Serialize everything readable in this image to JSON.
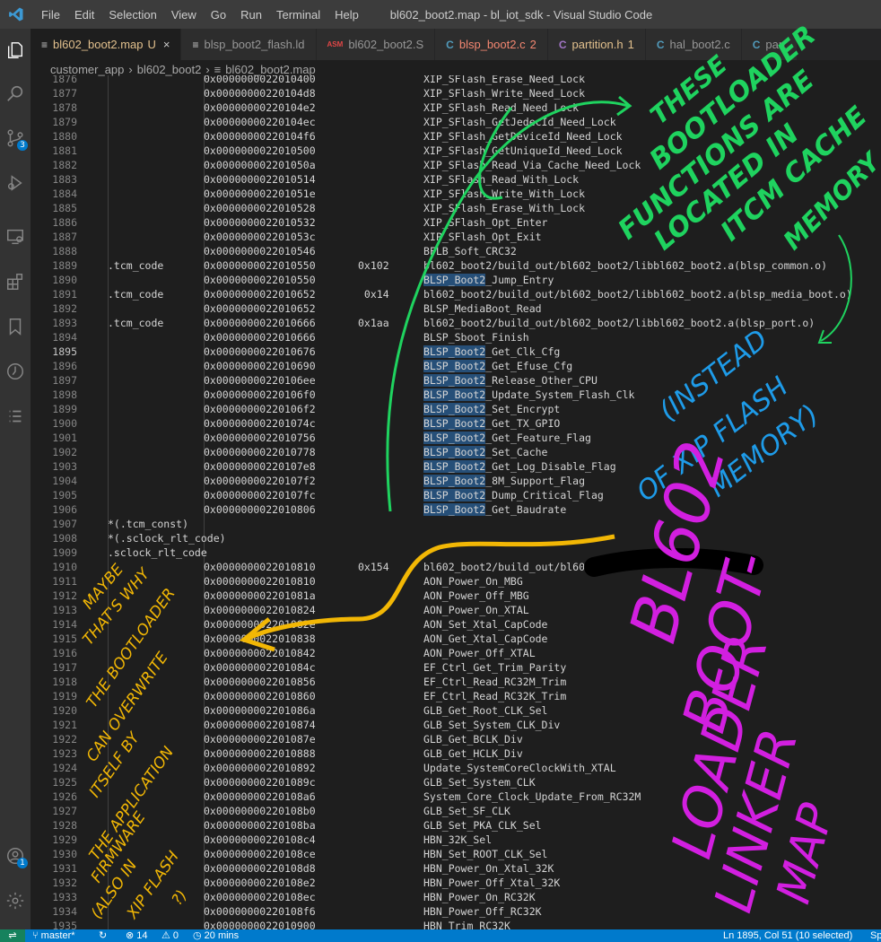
{
  "titlebar": {
    "menu": [
      "File",
      "Edit",
      "Selection",
      "View",
      "Go",
      "Run",
      "Terminal",
      "Help"
    ],
    "title": "bl602_boot2.map - bl_iot_sdk - Visual Studio Code"
  },
  "activity": {
    "icons": [
      "explorer-icon",
      "search-icon",
      "source-control-icon",
      "run-debug-icon",
      "remote-explorer-icon",
      "extensions-icon",
      "bookmarks-icon",
      "timeline-icon",
      "outline-icon",
      "account-icon",
      "settings-gear-icon"
    ],
    "scm_badge": "3",
    "account_badge": "1"
  },
  "tabs": [
    {
      "icon": "≡",
      "icon_color": "#cccccc",
      "label": "bl602_boot2.map",
      "suffix": "U",
      "active": true
    },
    {
      "icon": "≡",
      "icon_color": "#cccccc",
      "label": "blsp_boot2_flash.ld",
      "suffix": "",
      "active": false
    },
    {
      "icon": "ASM",
      "icon_color": "#e04646",
      "label": "bl602_boot2.S",
      "suffix": "",
      "active": false
    },
    {
      "icon": "C",
      "icon_color": "#519aba",
      "label": "blsp_boot2.c",
      "suffix": "2",
      "active": false,
      "color": "#f48771"
    },
    {
      "icon": "C",
      "icon_color": "#a074c4",
      "label": "partition.h",
      "suffix": "1",
      "active": false,
      "color": "#e2c08d"
    },
    {
      "icon": "C",
      "icon_color": "#519aba",
      "label": "hal_boot2.c",
      "suffix": "",
      "active": false
    },
    {
      "icon": "C",
      "icon_color": "#519aba",
      "label": "part",
      "suffix": "",
      "active": false
    }
  ],
  "breadcrumb": [
    "customer_app",
    "bl602_boot2",
    "bl602_boot2.map"
  ],
  "code": {
    "selection": "BLSP_Boot2",
    "current_line": "1895",
    "lines": [
      {
        "n": "1876",
        "a": "",
        "b": "0x0000000022010400",
        "c": "",
        "d": "XIP_SFlash_Erase_Need_Lock"
      },
      {
        "n": "1877",
        "a": "",
        "b": "0x00000000220104d8",
        "c": "",
        "d": "XIP_SFlash_Write_Need_Lock"
      },
      {
        "n": "1878",
        "a": "",
        "b": "0x00000000220104e2",
        "c": "",
        "d": "XIP_SFlash_Read_Need_Lock"
      },
      {
        "n": "1879",
        "a": "",
        "b": "0x00000000220104ec",
        "c": "",
        "d": "XIP_SFlash_GetJedecId_Need_Lock"
      },
      {
        "n": "1880",
        "a": "",
        "b": "0x00000000220104f6",
        "c": "",
        "d": "XIP_SFlash_GetDeviceId_Need_Lock"
      },
      {
        "n": "1881",
        "a": "",
        "b": "0x0000000022010500",
        "c": "",
        "d": "XIP_SFlash_GetUniqueId_Need_Lock"
      },
      {
        "n": "1882",
        "a": "",
        "b": "0x000000002201050a",
        "c": "",
        "d": "XIP_SFlash_Read_Via_Cache_Need_Lock"
      },
      {
        "n": "1883",
        "a": "",
        "b": "0x0000000022010514",
        "c": "",
        "d": "XIP_SFlash_Read_With_Lock"
      },
      {
        "n": "1884",
        "a": "",
        "b": "0x000000002201051e",
        "c": "",
        "d": "XIP_SFlash_Write_With_Lock"
      },
      {
        "n": "1885",
        "a": "",
        "b": "0x0000000022010528",
        "c": "",
        "d": "XIP_SFlash_Erase_With_Lock"
      },
      {
        "n": "1886",
        "a": "",
        "b": "0x0000000022010532",
        "c": "",
        "d": "XIP_SFlash_Opt_Enter"
      },
      {
        "n": "1887",
        "a": "",
        "b": "0x000000002201053c",
        "c": "",
        "d": "XIP_SFlash_Opt_Exit"
      },
      {
        "n": "1888",
        "a": "",
        "b": "0x0000000022010546",
        "c": "",
        "d": "BFLB_Soft_CRC32"
      },
      {
        "n": "1889",
        "a": ".tcm_code",
        "b": "0x0000000022010550",
        "c": "0x102",
        "d": "bl602_boot2/build_out/bl602_boot2/libbl602_boot2.a(blsp_common.o)"
      },
      {
        "n": "1890",
        "a": "",
        "b": "0x0000000022010550",
        "c": "",
        "d": "BLSP_Boot2_Jump_Entry"
      },
      {
        "n": "1891",
        "a": ".tcm_code",
        "b": "0x0000000022010652",
        "c": " 0x14",
        "d": "bl602_boot2/build_out/bl602_boot2/libbl602_boot2.a(blsp_media_boot.o)"
      },
      {
        "n": "1892",
        "a": "",
        "b": "0x0000000022010652",
        "c": "",
        "d": "BLSP_MediaBoot_Read"
      },
      {
        "n": "1893",
        "a": ".tcm_code",
        "b": "0x0000000022010666",
        "c": "0x1aa",
        "d": "bl602_boot2/build_out/bl602_boot2/libbl602_boot2.a(blsp_port.o)"
      },
      {
        "n": "1894",
        "a": "",
        "b": "0x0000000022010666",
        "c": "",
        "d": "BLSP_Sboot_Finish"
      },
      {
        "n": "1895",
        "a": "",
        "b": "0x0000000022010676",
        "c": "",
        "d": "BLSP_Boot2_Get_Clk_Cfg"
      },
      {
        "n": "1896",
        "a": "",
        "b": "0x0000000022010690",
        "c": "",
        "d": "BLSP_Boot2_Get_Efuse_Cfg"
      },
      {
        "n": "1897",
        "a": "",
        "b": "0x00000000220106ee",
        "c": "",
        "d": "BLSP_Boot2_Release_Other_CPU"
      },
      {
        "n": "1898",
        "a": "",
        "b": "0x00000000220106f0",
        "c": "",
        "d": "BLSP_Boot2_Update_System_Flash_Clk"
      },
      {
        "n": "1899",
        "a": "",
        "b": "0x00000000220106f2",
        "c": "",
        "d": "BLSP_Boot2_Set_Encrypt"
      },
      {
        "n": "1900",
        "a": "",
        "b": "0x000000002201074c",
        "c": "",
        "d": "BLSP_Boot2_Get_TX_GPIO"
      },
      {
        "n": "1901",
        "a": "",
        "b": "0x0000000022010756",
        "c": "",
        "d": "BLSP_Boot2_Get_Feature_Flag"
      },
      {
        "n": "1902",
        "a": "",
        "b": "0x0000000022010778",
        "c": "",
        "d": "BLSP_Boot2_Set_Cache"
      },
      {
        "n": "1903",
        "a": "",
        "b": "0x00000000220107e8",
        "c": "",
        "d": "BLSP_Boot2_Get_Log_Disable_Flag"
      },
      {
        "n": "1904",
        "a": "",
        "b": "0x00000000220107f2",
        "c": "",
        "d": "BLSP_Boot2_8M_Support_Flag"
      },
      {
        "n": "1905",
        "a": "",
        "b": "0x00000000220107fc",
        "c": "",
        "d": "BLSP_Boot2_Dump_Critical_Flag"
      },
      {
        "n": "1906",
        "a": "",
        "b": "0x0000000022010806",
        "c": "",
        "d": "BLSP_Boot2_Get_Baudrate"
      },
      {
        "n": "1907",
        "a": "*(.tcm_const)",
        "b": "",
        "c": "",
        "d": ""
      },
      {
        "n": "1908",
        "a": "*(.sclock_rlt_code)",
        "b": "",
        "c": "",
        "d": ""
      },
      {
        "n": "1909",
        "a": ".sclock_rlt_code",
        "b": "",
        "c": "",
        "d": ""
      },
      {
        "n": "1910",
        "a": "",
        "b": "0x0000000022010810",
        "c": "0x154",
        "d": "bl602_boot2/build_out/bl602_st"
      },
      {
        "n": "1911",
        "a": "",
        "b": "0x0000000022010810",
        "c": "",
        "d": "AON_Power_On_MBG"
      },
      {
        "n": "1912",
        "a": "",
        "b": "0x000000002201081a",
        "c": "",
        "d": "AON_Power_Off_MBG"
      },
      {
        "n": "1913",
        "a": "",
        "b": "0x0000000022010824",
        "c": "",
        "d": "AON_Power_On_XTAL"
      },
      {
        "n": "1914",
        "a": "",
        "b": "0x000000002201082e",
        "c": "",
        "d": "AON_Set_Xtal_CapCode"
      },
      {
        "n": "1915",
        "a": "",
        "b": "0x0000000022010838",
        "c": "",
        "d": "AON_Get_Xtal_CapCode"
      },
      {
        "n": "1916",
        "a": "",
        "b": "0x0000000022010842",
        "c": "",
        "d": "AON_Power_Off_XTAL"
      },
      {
        "n": "1917",
        "a": "",
        "b": "0x000000002201084c",
        "c": "",
        "d": "EF_Ctrl_Get_Trim_Parity"
      },
      {
        "n": "1918",
        "a": "",
        "b": "0x0000000022010856",
        "c": "",
        "d": "EF_Ctrl_Read_RC32M_Trim"
      },
      {
        "n": "1919",
        "a": "",
        "b": "0x0000000022010860",
        "c": "",
        "d": "EF_Ctrl_Read_RC32K_Trim"
      },
      {
        "n": "1920",
        "a": "",
        "b": "0x000000002201086a",
        "c": "",
        "d": "GLB_Get_Root_CLK_Sel"
      },
      {
        "n": "1921",
        "a": "",
        "b": "0x0000000022010874",
        "c": "",
        "d": "GLB_Set_System_CLK_Div"
      },
      {
        "n": "1922",
        "a": "",
        "b": "0x000000002201087e",
        "c": "",
        "d": "GLB_Get_BCLK_Div"
      },
      {
        "n": "1923",
        "a": "",
        "b": "0x0000000022010888",
        "c": "",
        "d": "GLB_Get_HCLK_Div"
      },
      {
        "n": "1924",
        "a": "",
        "b": "0x0000000022010892",
        "c": "",
        "d": "Update_SystemCoreClockWith_XTAL"
      },
      {
        "n": "1925",
        "a": "",
        "b": "0x000000002201089c",
        "c": "",
        "d": "GLB_Set_System_CLK"
      },
      {
        "n": "1926",
        "a": "",
        "b": "0x00000000220108a6",
        "c": "",
        "d": "System_Core_Clock_Update_From_RC32M"
      },
      {
        "n": "1927",
        "a": "",
        "b": "0x00000000220108b0",
        "c": "",
        "d": "GLB_Set_SF_CLK"
      },
      {
        "n": "1928",
        "a": "",
        "b": "0x00000000220108ba",
        "c": "",
        "d": "GLB_Set_PKA_CLK_Sel"
      },
      {
        "n": "1929",
        "a": "",
        "b": "0x00000000220108c4",
        "c": "",
        "d": "HBN_32K_Sel"
      },
      {
        "n": "1930",
        "a": "",
        "b": "0x00000000220108ce",
        "c": "",
        "d": "HBN_Set_ROOT_CLK_Sel"
      },
      {
        "n": "1931",
        "a": "",
        "b": "0x00000000220108d8",
        "c": "",
        "d": "HBN_Power_On_Xtal_32K"
      },
      {
        "n": "1932",
        "a": "",
        "b": "0x00000000220108e2",
        "c": "",
        "d": "HBN_Power_Off_Xtal_32K"
      },
      {
        "n": "1933",
        "a": "",
        "b": "0x00000000220108ec",
        "c": "",
        "d": "HBN_Power_On_RC32K"
      },
      {
        "n": "1934",
        "a": "",
        "b": "0x00000000220108f6",
        "c": "",
        "d": "HBN_Power_Off_RC32K"
      },
      {
        "n": "1935",
        "a": "",
        "b": "0x0000000022010900",
        "c": "",
        "d": "HBN_Trim_RC32K"
      }
    ]
  },
  "annotations": {
    "green": [
      "THESE",
      "BOOTLOADER",
      "FUNCTIONS ARE",
      "LOCATED IN",
      "ITCM CACHE",
      "MEMORY"
    ],
    "blue": [
      "(INSTEAD",
      "OF XIP FLASH",
      "MEMORY)"
    ],
    "orange": [
      "MAYBE",
      "THAT'S WHY",
      "THE BOOTLOADER",
      "CAN OVERWRITE",
      "ITSELF BY",
      "THE APPLICATION",
      "FIRMWARE",
      "(ALSO IN",
      "XIP FLASH",
      "?)"
    ],
    "magenta": [
      "BL602",
      "BOOT-",
      "LOADER",
      "LINKER",
      "MAP"
    ],
    "colors": {
      "green": "#1fd35f",
      "blue": "#1e9be8",
      "orange": "#f2b705",
      "magenta": "#d21fe0"
    }
  },
  "statusbar": {
    "branch": "master*",
    "sync": "↻",
    "errors": "⊗ 14",
    "warnings": "⚠ 0",
    "wakatime": "20 mins",
    "position": "Ln 1895, Col 51 (10 selected)",
    "spaces": "Sp"
  }
}
